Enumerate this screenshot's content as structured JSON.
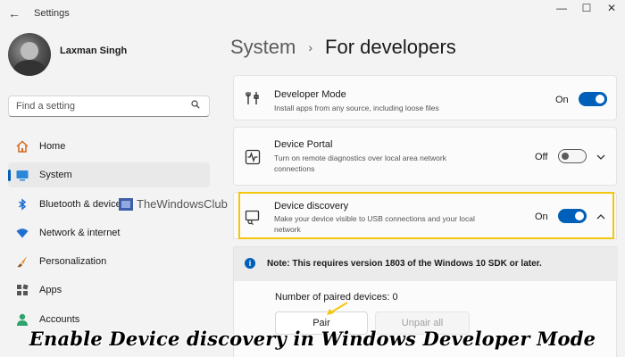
{
  "window": {
    "title": "Settings",
    "back_icon": "arrow-left-icon",
    "minimize_glyph": "—",
    "maximize_glyph": "☐",
    "close_glyph": "✕"
  },
  "user": {
    "name": "Laxman Singh"
  },
  "search": {
    "placeholder": "Find a setting"
  },
  "sidebar": {
    "items": [
      {
        "label": "Home",
        "icon": "home-icon",
        "active": false
      },
      {
        "label": "System",
        "icon": "system-icon",
        "active": true
      },
      {
        "label": "Bluetooth & devices",
        "icon": "bluetooth-icon",
        "active": false
      },
      {
        "label": "Network & internet",
        "icon": "wifi-icon",
        "active": false
      },
      {
        "label": "Personalization",
        "icon": "brush-icon",
        "active": false
      },
      {
        "label": "Apps",
        "icon": "apps-icon",
        "active": false
      },
      {
        "label": "Accounts",
        "icon": "accounts-icon",
        "active": false
      }
    ]
  },
  "watermark": {
    "text": "TheWindowsClub"
  },
  "breadcrumb": {
    "parent": "System",
    "separator": "›",
    "current": "For developers"
  },
  "settings": [
    {
      "title": "Developer Mode",
      "description": "Install apps from any source, including loose files",
      "state": "On",
      "icon": "tools-icon"
    },
    {
      "title": "Device Portal",
      "description": "Turn on remote diagnostics over local area network connections",
      "state": "Off",
      "icon": "pulse-icon"
    },
    {
      "title": "Device discovery",
      "description": "Make your device visible to USB connections and your local network",
      "state": "On",
      "icon": "device-discovery-icon"
    }
  ],
  "note": {
    "text": "Note: This requires version 1803 of the Windows 10 SDK or later."
  },
  "paired": {
    "text": "Number of paired devices: 0"
  },
  "buttons": {
    "pair": "Pair",
    "unpair": "Unpair all"
  },
  "caption": {
    "text": "Enable Device discovery in Windows Developer Mode"
  },
  "colors": {
    "accent": "#005fb8",
    "highlight": "#f4c70f",
    "annotation_arrow": "#f4c70f"
  }
}
